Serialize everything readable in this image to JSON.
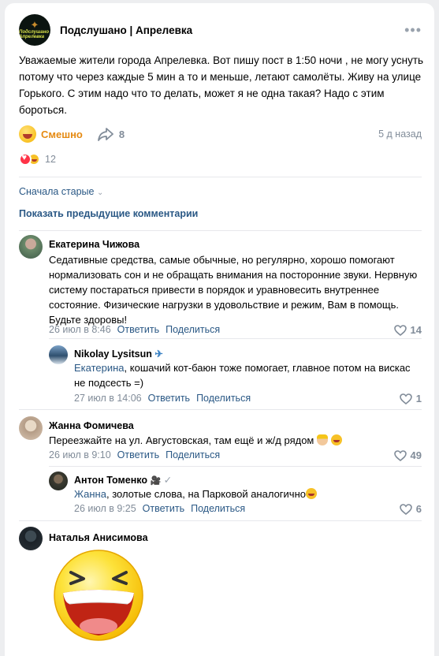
{
  "group": {
    "name": "Подслушано | Апрелевка",
    "avatar_text": "Подслушано Апрелевка"
  },
  "post": {
    "text": "Уважаемые жители города Апрелевка. Вот пишу пост в 1:50 ночи , не могу уснуть потому что через каждые 5 мин а то и меньше, летают самолёты. Живу на улице Горького. С этим надо что то делать, может я не одна такая? Надо с этим бороться.",
    "reaction_label": "Смешно",
    "shares": "8",
    "time": "5 д назад",
    "likes": "12"
  },
  "comments_sort": "Сначала старые",
  "show_previous": "Показать предыдущие комментарии",
  "actions": {
    "reply": "Ответить",
    "share": "Поделиться"
  },
  "comments": [
    {
      "author": "Екатерина Чижова",
      "text": "Седативные средства, самые обычные, но регулярно, хорошо помогают нормализовать сон и не обращать внимания на посторонние звуки. Нервную систему постараться привести в порядок и уравновесить внутреннее состояние. Физические нагрузки в удовольствие и режим, Вам в помощь. Будьте здоровы!",
      "date": "26 июл в 8:46",
      "likes": "14"
    },
    {
      "author": "Nikolay Lysitsun",
      "author_emoji": "✈",
      "mention": "Екатерина",
      "text": ", кошачий кот-баюн тоже помогает, главное потом на вискас не подсесть =)",
      "date": "27 июл в 14:06",
      "likes": "1"
    },
    {
      "author": "Жанна Фомичева",
      "text": "Переезжайте на ул. Августовская, там ещё и ж/д рядом",
      "date": "26 июл в 9:10",
      "likes": "49"
    },
    {
      "author": "Антон Томенко",
      "author_emoji": "🎥",
      "mention": "Жанна",
      "text": ", золотые слова, на Парковой аналогично",
      "date": "26 июл в 9:25",
      "likes": "6"
    },
    {
      "author": "Наталья Анисимова"
    }
  ]
}
